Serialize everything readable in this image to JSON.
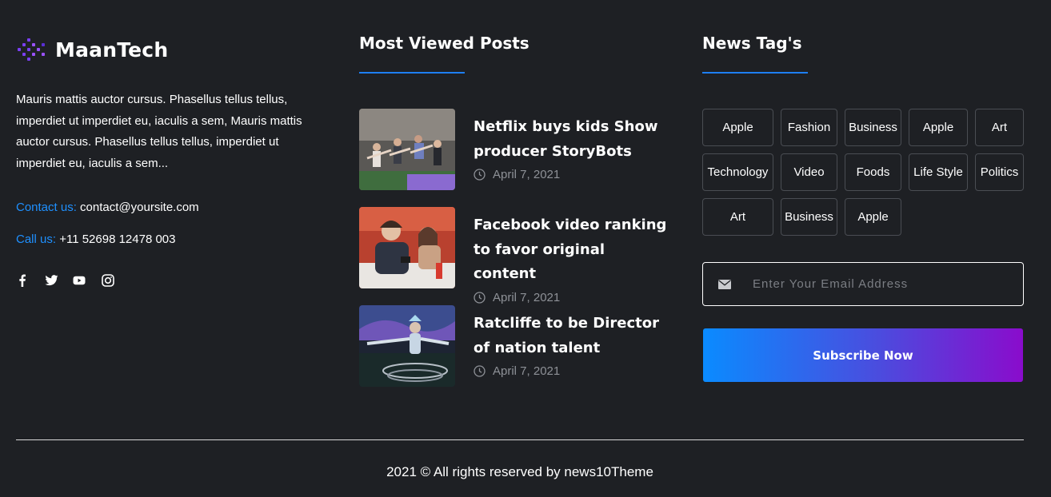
{
  "brand": {
    "name": "MaanTech",
    "accent": "#1e7ff5",
    "logo_colors": [
      "#6a3df5",
      "#9b4dff"
    ]
  },
  "about": {
    "text": "Mauris mattis auctor cursus. Phasellus tellus tellus, imperdiet ut imperdiet eu, iaculis a sem, Mauris mattis auctor cursus. Phasellus tellus tellus, imperdiet ut imperdiet eu, iaculis a sem..."
  },
  "contact": {
    "email_label": "Contact us:",
    "email_value": "contact@yoursite.com",
    "phone_label": "Call us:",
    "phone_value": "+11 52698 12478 003"
  },
  "socials": [
    {
      "icon": "facebook-icon"
    },
    {
      "icon": "twitter-icon"
    },
    {
      "icon": "youtube-icon"
    },
    {
      "icon": "instagram-icon"
    }
  ],
  "most_viewed": {
    "heading": "Most Viewed Posts",
    "posts": [
      {
        "title": "Netflix buys kids Show producer StoryBots",
        "date": "April 7, 2021"
      },
      {
        "title": "Facebook video ranking to favor original content",
        "date": "April 7, 2021"
      },
      {
        "title": "Ratcliffe to be Director of nation talent",
        "date": "April 7, 2021"
      }
    ]
  },
  "news_tags": {
    "heading": "News Tag's",
    "tags": [
      "Apple",
      "Fashion",
      "Business",
      "Apple",
      "Art",
      "Technology",
      "Video",
      "Foods",
      "Life Style",
      "Politics",
      "Art",
      "Business",
      "Apple"
    ]
  },
  "newsletter": {
    "placeholder": "Enter Your Email Address",
    "button_label": "Subscribe Now",
    "gradient": [
      "#0a8bff",
      "#8a0ccc"
    ]
  },
  "footer": {
    "copyright": "2021 © All rights reserved by news10Theme"
  }
}
